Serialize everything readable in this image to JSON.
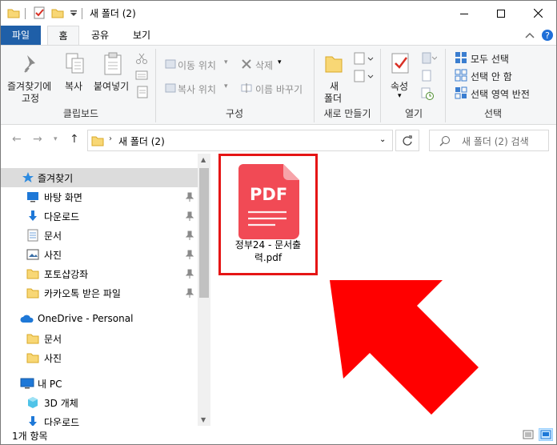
{
  "window": {
    "title": "새 폴더 (2)"
  },
  "tabs": [
    {
      "label": "파일"
    },
    {
      "label": "홈"
    },
    {
      "label": "공유"
    },
    {
      "label": "보기"
    }
  ],
  "ribbon": {
    "clipboard": {
      "pin_label_1": "즐겨찾기에",
      "pin_label_2": "고정",
      "copy": "복사",
      "paste": "붙여넣기",
      "group": "클립보드"
    },
    "organize": {
      "move_to": "이동 위치",
      "copy_to": "복사 위치",
      "delete": "삭제",
      "rename": "이름 바꾸기",
      "group": "구성"
    },
    "new": {
      "new_folder_1": "새",
      "new_folder_2": "폴더",
      "group": "새로 만들기"
    },
    "open": {
      "properties": "속성",
      "group": "열기"
    },
    "select": {
      "select_all": "모두 선택",
      "select_none": "선택 안 함",
      "invert": "선택 영역 반전",
      "group": "선택"
    }
  },
  "address": {
    "path": "새 폴더 (2)",
    "search_placeholder": "새 폴더 (2) 검색"
  },
  "nav": {
    "quick_access": "즐겨찾기",
    "items": [
      {
        "label": "바탕 화면",
        "icon": "desktop-icon"
      },
      {
        "label": "다운로드",
        "icon": "download-icon"
      },
      {
        "label": "문서",
        "icon": "document-icon"
      },
      {
        "label": "사진",
        "icon": "pictures-icon"
      },
      {
        "label": "포토샵강좌",
        "icon": "folder-icon"
      },
      {
        "label": "카카오톡 받은 파일",
        "icon": "folder-icon"
      }
    ],
    "onedrive": "OneDrive - Personal",
    "onedrive_items": [
      {
        "label": "문서"
      },
      {
        "label": "사진"
      }
    ],
    "this_pc": "내 PC",
    "pc_items": [
      {
        "label": "3D 개체"
      },
      {
        "label": "다운로드"
      }
    ]
  },
  "file": {
    "name_line1": "정부24 - 문서출",
    "name_line2": "력.pdf",
    "icon_text": "PDF"
  },
  "status": {
    "count": "1개 항목"
  },
  "colors": {
    "pdf_red": "#f14a55",
    "highlight_border": "#e51515",
    "arrow_red": "#ff0000",
    "file_tab": "#1f5fa8",
    "folder_yellow": "#f8d775"
  }
}
